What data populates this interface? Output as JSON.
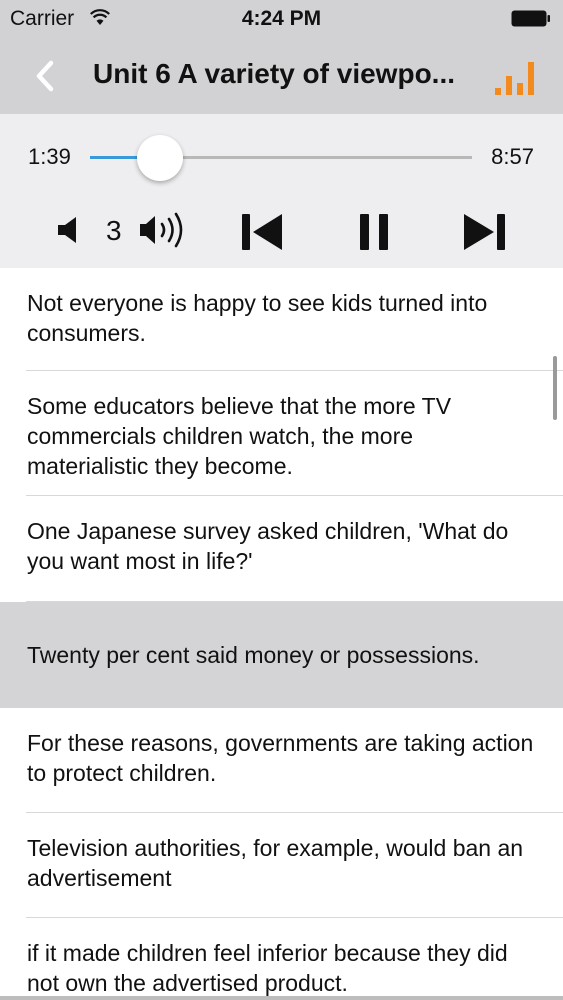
{
  "status_bar": {
    "carrier": "Carrier",
    "time": "4:24 PM"
  },
  "nav": {
    "title": "Unit 6 A variety of viewpo...",
    "accent_color": "#f28a1e"
  },
  "player": {
    "current_time": "1:39",
    "total_time": "8:57",
    "progress": 0.184,
    "volume_level": "3",
    "accent_color": "#3a9ad9"
  },
  "sentences": [
    {
      "text": "Not everyone is happy to see kids turned into consumers.",
      "active": false
    },
    {
      "text": "Some educators believe that the more TV commercials children watch, the more materialistic they become.",
      "active": false
    },
    {
      "text": "One Japanese survey asked children, 'What do you want most in life?'",
      "active": false
    },
    {
      "text": "Twenty per cent said money or possessions.",
      "active": true
    },
    {
      "text": "For these reasons, governments are taking action to protect children.",
      "active": false
    },
    {
      "text": "Television authorities, for example, would ban an advertisement",
      "active": false
    },
    {
      "text": "if it made children feel inferior because they did not own the advertised product.",
      "active": false
    }
  ]
}
